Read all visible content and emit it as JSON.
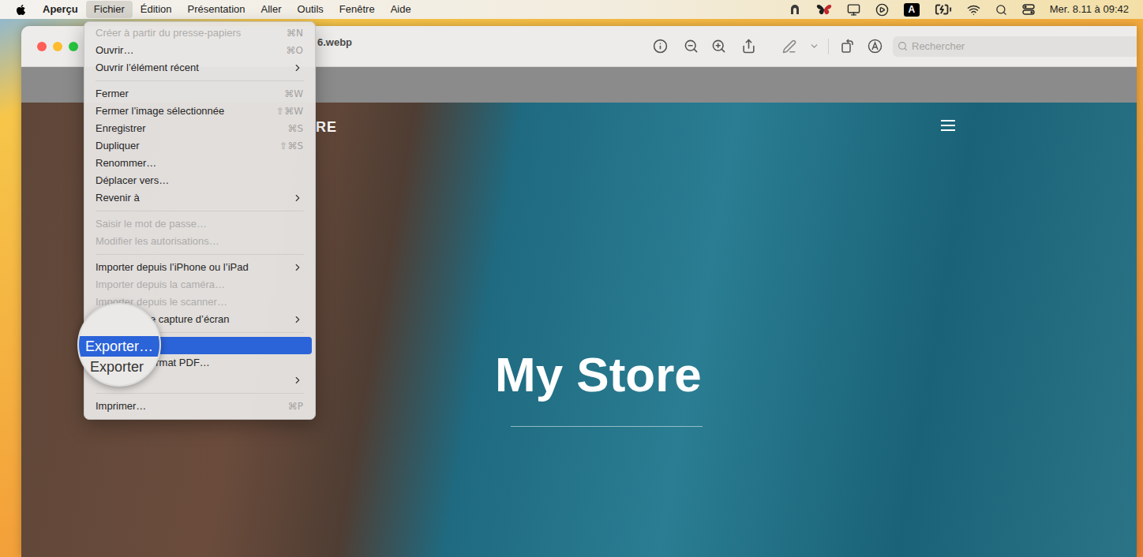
{
  "menubar": {
    "app": "Aperçu",
    "menus": [
      {
        "label": "Fichier",
        "selected": true
      },
      {
        "label": "Édition",
        "selected": false
      },
      {
        "label": "Présentation",
        "selected": false
      },
      {
        "label": "Aller",
        "selected": false
      },
      {
        "label": "Outils",
        "selected": false
      },
      {
        "label": "Fenêtre",
        "selected": false
      },
      {
        "label": "Aide",
        "selected": false
      }
    ],
    "input_source": "A",
    "clock": "Mer. 8.11 à 09:42"
  },
  "window": {
    "title": "6.webp",
    "search": {
      "placeholder": "Rechercher"
    }
  },
  "menu": {
    "items": [
      {
        "kind": "item",
        "label": "Créer à partir du presse-papiers",
        "shortcut": "⌘N",
        "disabled": true,
        "submenu": false,
        "selected": false
      },
      {
        "kind": "item",
        "label": "Ouvrir…",
        "shortcut": "⌘O",
        "disabled": false,
        "submenu": false,
        "selected": false
      },
      {
        "kind": "item",
        "label": "Ouvrir l’élément récent",
        "shortcut": "",
        "disabled": false,
        "submenu": true,
        "selected": false
      },
      {
        "kind": "separator"
      },
      {
        "kind": "item",
        "label": "Fermer",
        "shortcut": "⌘W",
        "disabled": false,
        "submenu": false,
        "selected": false
      },
      {
        "kind": "item",
        "label": "Fermer l’image sélectionnée",
        "shortcut": "⇧⌘W",
        "disabled": false,
        "submenu": false,
        "selected": false
      },
      {
        "kind": "item",
        "label": "Enregistrer",
        "shortcut": "⌘S",
        "disabled": false,
        "submenu": false,
        "selected": false
      },
      {
        "kind": "item",
        "label": "Dupliquer",
        "shortcut": "⇧⌘S",
        "disabled": false,
        "submenu": false,
        "selected": false
      },
      {
        "kind": "item",
        "label": "Renommer…",
        "shortcut": "",
        "disabled": false,
        "submenu": false,
        "selected": false
      },
      {
        "kind": "item",
        "label": "Déplacer vers…",
        "shortcut": "",
        "disabled": false,
        "submenu": false,
        "selected": false
      },
      {
        "kind": "item",
        "label": "Revenir à",
        "shortcut": "",
        "disabled": false,
        "submenu": true,
        "selected": false
      },
      {
        "kind": "separator"
      },
      {
        "kind": "item",
        "label": "Saisir le mot de passe…",
        "shortcut": "",
        "disabled": true,
        "submenu": false,
        "selected": false
      },
      {
        "kind": "item",
        "label": "Modifier les autorisations…",
        "shortcut": "",
        "disabled": true,
        "submenu": false,
        "selected": false
      },
      {
        "kind": "separator"
      },
      {
        "kind": "item",
        "label": "Importer depuis l’iPhone ou l’iPad",
        "shortcut": "",
        "disabled": false,
        "submenu": true,
        "selected": false
      },
      {
        "kind": "item",
        "label": "Importer depuis la caméra…",
        "shortcut": "",
        "disabled": true,
        "submenu": false,
        "selected": false
      },
      {
        "kind": "item",
        "label": "Importer depuis le scanner…",
        "shortcut": "",
        "disabled": true,
        "submenu": false,
        "selected": false
      },
      {
        "kind": "covered",
        "label": "e capture d’écran",
        "shortcut": "",
        "disabled": false,
        "submenu": true,
        "selected": false
      },
      {
        "kind": "separator"
      },
      {
        "kind": "covered",
        "label": "",
        "shortcut": "",
        "disabled": false,
        "submenu": false,
        "selected": true
      },
      {
        "kind": "covered",
        "label": "ormat PDF…",
        "shortcut": "",
        "disabled": false,
        "submenu": false,
        "selected": false
      },
      {
        "kind": "covered",
        "label": "",
        "shortcut": "",
        "disabled": false,
        "submenu": true,
        "selected": false
      },
      {
        "kind": "separator"
      },
      {
        "kind": "item",
        "label": "Imprimer…",
        "shortcut": "⌘P",
        "disabled": false,
        "submenu": false,
        "selected": false
      }
    ]
  },
  "magnifier": {
    "lines": [
      {
        "label": "Exporter…",
        "selected": true
      },
      {
        "label": "Exporter",
        "selected": false
      }
    ]
  },
  "image": {
    "logo": "RE",
    "heading": "My Store"
  }
}
